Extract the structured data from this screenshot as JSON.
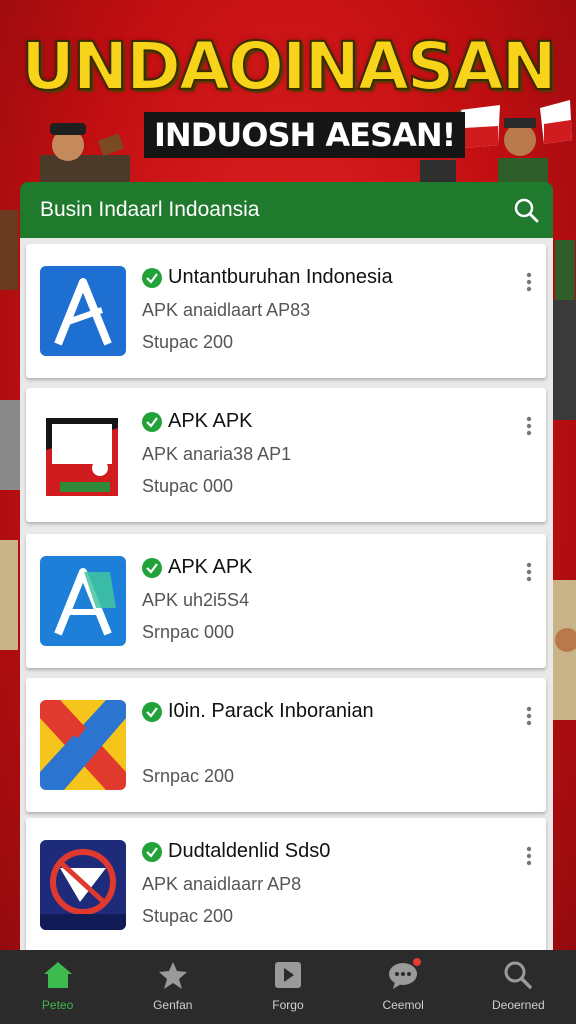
{
  "banner": {
    "title": "UNDAOINASAN",
    "subtitle": "INDUOSH AESAN!"
  },
  "search": {
    "placeholder": "Busin Indaarl Indoansia",
    "icon": "search-icon"
  },
  "apps": [
    {
      "title": "Untantburuhan Indonesia",
      "subtitle": "APK anaidlaart AP83",
      "size": "Stupac 200",
      "verified": true
    },
    {
      "title": "APK APK",
      "subtitle": "APK anaria38 AP1",
      "size": "Stupac 000",
      "verified": true
    },
    {
      "title": "APK APK",
      "subtitle": "APK uh2i5S4",
      "size": "Srnpac 000",
      "verified": true
    },
    {
      "title": "I0in. Parack Inboranian",
      "subtitle": "",
      "size": "Srnpac 200",
      "verified": true
    },
    {
      "title": "Dudtaldenlid Sds0",
      "subtitle": "APK anaidlaarr AP8",
      "size": "Stupac 200",
      "verified": true
    }
  ],
  "nav": [
    {
      "label": "Peteo",
      "icon": "home-icon",
      "active": true
    },
    {
      "label": "Genfan",
      "icon": "star-icon",
      "active": false
    },
    {
      "label": "Forgo",
      "icon": "film-icon",
      "active": false
    },
    {
      "label": "Ceemol",
      "icon": "chat-icon",
      "active": false
    },
    {
      "label": "Deoerned",
      "icon": "search-icon",
      "active": false
    }
  ],
  "colors": {
    "background": "#c40f12",
    "header_green": "#1f7a2e",
    "title_yellow": "#f7d31a",
    "verified_green": "#22a33a",
    "nav_active": "#3dbb4e"
  }
}
